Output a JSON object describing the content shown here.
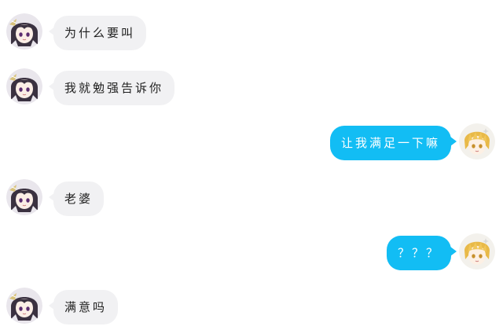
{
  "messages": [
    {
      "side": "left",
      "sender": "dark-hair-user",
      "text": "为什么要叫"
    },
    {
      "side": "left",
      "sender": "dark-hair-user",
      "text": "我就勉强告诉你"
    },
    {
      "side": "right",
      "sender": "blond-hair-user",
      "text": "让我满足一下嘛"
    },
    {
      "side": "left",
      "sender": "dark-hair-user",
      "text": "老婆"
    },
    {
      "side": "right",
      "sender": "blond-hair-user",
      "text": "？？？"
    },
    {
      "side": "left",
      "sender": "dark-hair-user",
      "text": "满意吗"
    }
  ],
  "colors": {
    "incoming_bubble": "#f1f1f3",
    "outgoing_bubble": "#12bdf4",
    "incoming_text": "#1e1e1e",
    "outgoing_text": "#ffffff"
  }
}
